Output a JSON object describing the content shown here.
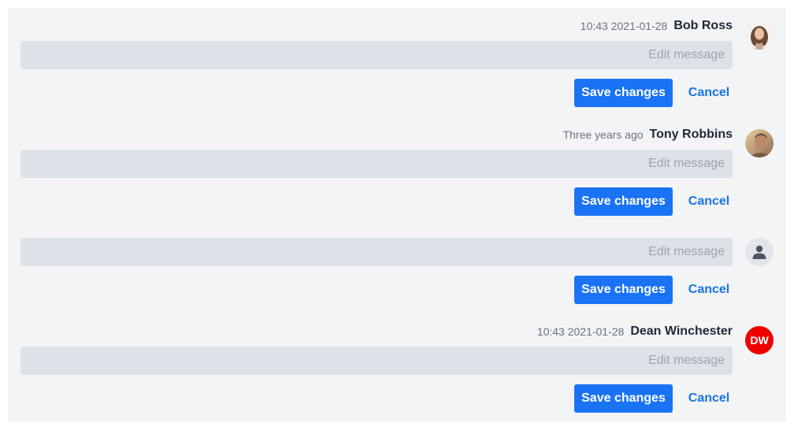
{
  "messages": [
    {
      "time": "10:43 2021-01-28",
      "author": "Bob Ross",
      "avatar": "photo-woman",
      "input_placeholder": "Edit message",
      "save_label": "Save changes",
      "cancel_label": "Cancel"
    },
    {
      "time": "Three years ago",
      "author": "Tony Robbins",
      "avatar": "photo-man",
      "input_placeholder": "Edit message",
      "save_label": "Save changes",
      "cancel_label": "Cancel"
    },
    {
      "avatar": "default-user-icon",
      "input_placeholder": "Edit message",
      "save_label": "Save changes",
      "cancel_label": "Cancel"
    },
    {
      "time": "10:43 2021-01-28",
      "author": "Dean Winchester",
      "avatar_initials": "DW",
      "avatar_color": "#ee0000",
      "input_placeholder": "Edit message",
      "save_label": "Save changes",
      "cancel_label": "Cancel"
    }
  ],
  "colors": {
    "primary": "#1a73f5",
    "link": "#1a73e8",
    "panel_background": "#f3f4f6",
    "input_background": "#dde1e8"
  }
}
